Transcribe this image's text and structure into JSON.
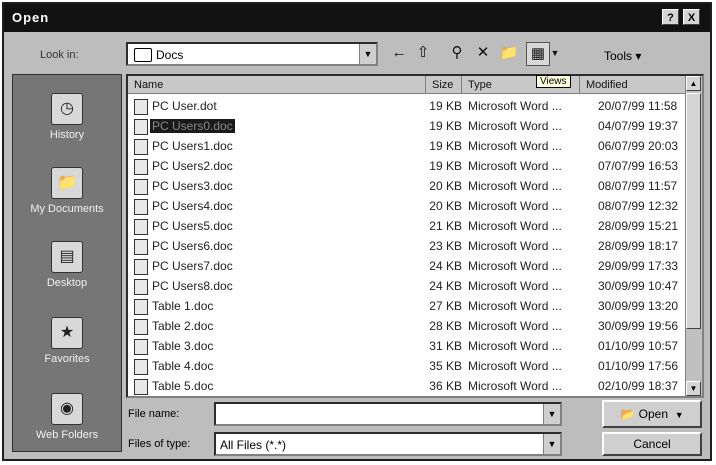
{
  "window": {
    "title": "Open"
  },
  "titlebar": {
    "help": "?",
    "close": "X"
  },
  "toolbar": {
    "look_in_label": "Look in:",
    "look_in_value": "Docs",
    "tools_label": "Tools",
    "views_tooltip": "Views"
  },
  "places": [
    {
      "label": "History",
      "icon": "history-icon"
    },
    {
      "label": "My Documents",
      "icon": "my-documents-icon"
    },
    {
      "label": "Desktop",
      "icon": "desktop-icon"
    },
    {
      "label": "Favorites",
      "icon": "favorites-icon"
    },
    {
      "label": "Web Folders",
      "icon": "web-folders-icon"
    }
  ],
  "columns": {
    "name": "Name",
    "size": "Size",
    "type": "Type",
    "modified": "Modified"
  },
  "files": [
    {
      "name": "PC User.dot",
      "size": "19 KB",
      "type": "Microsoft Word ...",
      "modified": "20/07/99 11:58"
    },
    {
      "name": "PC Users0.doc",
      "size": "19 KB",
      "type": "Microsoft Word ...",
      "modified": "04/07/99 19:37",
      "selected": true
    },
    {
      "name": "PC Users1.doc",
      "size": "19 KB",
      "type": "Microsoft Word ...",
      "modified": "06/07/99 20:03"
    },
    {
      "name": "PC Users2.doc",
      "size": "19 KB",
      "type": "Microsoft Word ...",
      "modified": "07/07/99 16:53"
    },
    {
      "name": "PC Users3.doc",
      "size": "20 KB",
      "type": "Microsoft Word ...",
      "modified": "08/07/99 11:57"
    },
    {
      "name": "PC Users4.doc",
      "size": "20 KB",
      "type": "Microsoft Word ...",
      "modified": "08/07/99 12:32"
    },
    {
      "name": "PC Users5.doc",
      "size": "21 KB",
      "type": "Microsoft Word ...",
      "modified": "28/09/99 15:21"
    },
    {
      "name": "PC Users6.doc",
      "size": "23 KB",
      "type": "Microsoft Word ...",
      "modified": "28/09/99 18:17"
    },
    {
      "name": "PC Users7.doc",
      "size": "24 KB",
      "type": "Microsoft Word ...",
      "modified": "29/09/99 17:33"
    },
    {
      "name": "PC Users8.doc",
      "size": "24 KB",
      "type": "Microsoft Word ...",
      "modified": "30/09/99 10:47"
    },
    {
      "name": "Table 1.doc",
      "size": "27 KB",
      "type": "Microsoft Word ...",
      "modified": "30/09/99 13:20"
    },
    {
      "name": "Table 2.doc",
      "size": "28 KB",
      "type": "Microsoft Word ...",
      "modified": "30/09/99 19:56"
    },
    {
      "name": "Table 3.doc",
      "size": "31 KB",
      "type": "Microsoft Word ...",
      "modified": "01/10/99 10:57"
    },
    {
      "name": "Table 4.doc",
      "size": "35 KB",
      "type": "Microsoft Word ...",
      "modified": "01/10/99 17:56"
    },
    {
      "name": "Table 5.doc",
      "size": "36 KB",
      "type": "Microsoft Word ...",
      "modified": "02/10/99 18:37"
    }
  ],
  "footer": {
    "filename_label": "File name:",
    "filename_value": "",
    "filetype_label": "Files of type:",
    "filetype_value": "All Files (*.*)",
    "open_label": "Open",
    "cancel_label": "Cancel"
  }
}
